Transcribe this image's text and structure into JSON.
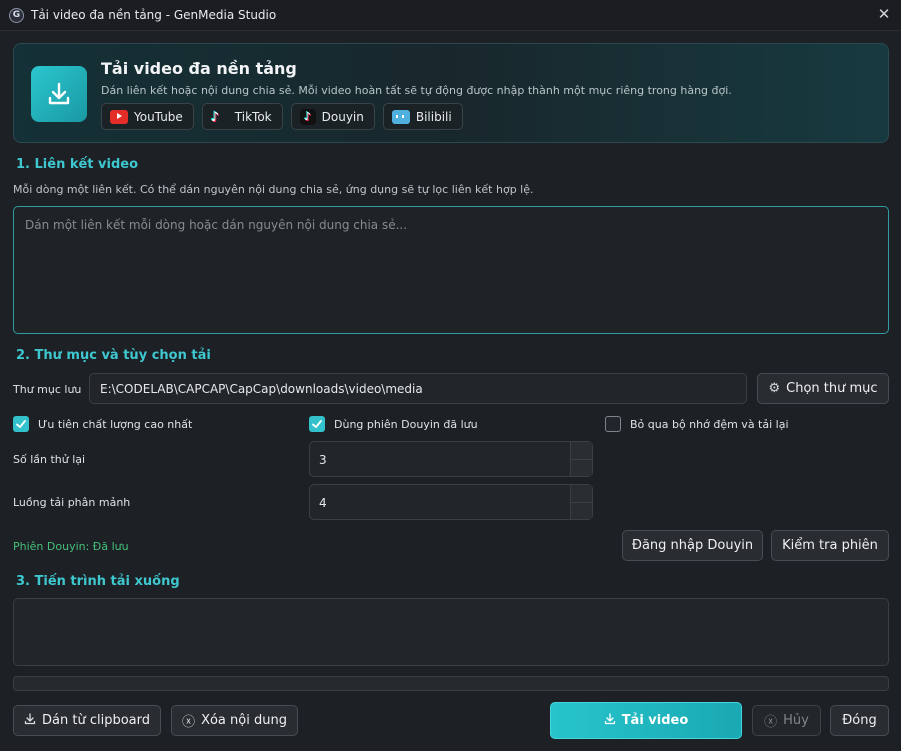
{
  "window": {
    "title": "Tải video đa nền tảng - GenMedia Studio",
    "app_icon_glyph": "G"
  },
  "header": {
    "title": "Tải video đa nền tảng",
    "subtitle": "Dán liên kết hoặc nội dung chia sẻ. Mỗi video hoàn tất sẽ tự động được nhập thành một mục riêng trong hàng đợi.",
    "platforms": [
      {
        "label": "YouTube",
        "icon": "youtube-icon",
        "color": "#e52d27"
      },
      {
        "label": "TikTok",
        "icon": "tiktok-icon",
        "color": "#25f4ee"
      },
      {
        "label": "Douyin",
        "icon": "douyin-icon",
        "color": "#fe2c55"
      },
      {
        "label": "Bilibili",
        "icon": "bilibili-icon",
        "color": "#4fb0e0"
      }
    ]
  },
  "links_section": {
    "heading": "1. Liên kết video",
    "hint": "Mỗi dòng một liên kết. Có thể dán nguyên nội dung chia sẻ, ứng dụng sẽ tự lọc liên kết hợp lệ.",
    "placeholder": "Dán một liên kết mỗi dòng hoặc dán nguyên nội dung chia sẻ...",
    "value": ""
  },
  "options_section": {
    "heading": "2. Thư mục và tùy chọn tải",
    "folder_label": "Thư mục lưu",
    "folder_value": "E:\\CODELAB\\CAPCAP\\CapCap\\downloads\\video\\media",
    "choose_folder_label": "Chọn thư mục",
    "checkboxes": [
      {
        "label": "Ưu tiên chất lượng cao nhất",
        "checked": true
      },
      {
        "label": "Dùng phiên Douyin đã lưu",
        "checked": true
      },
      {
        "label": "Bỏ qua bộ nhớ đệm và tải lại",
        "checked": false
      }
    ],
    "retries_label": "Số lần thử lại",
    "retries_value": "3",
    "threads_label": "Luồng tải phân mảnh",
    "threads_value": "4",
    "session_status": "Phiên Douyin: Đã lưu",
    "login_label": "Đăng nhập Douyin",
    "check_session_label": "Kiểm tra phiên"
  },
  "progress_section": {
    "heading": "3. Tiến trình tải xuống",
    "log": "",
    "progress": 0
  },
  "footer": {
    "paste_label": "Dán từ clipboard",
    "clear_label": "Xóa nội dung",
    "download_label": "Tải video",
    "cancel_label": "Hủy",
    "close_label": "Đóng"
  },
  "colors": {
    "accent": "#33c2cc",
    "status_ok": "#45c07a"
  }
}
